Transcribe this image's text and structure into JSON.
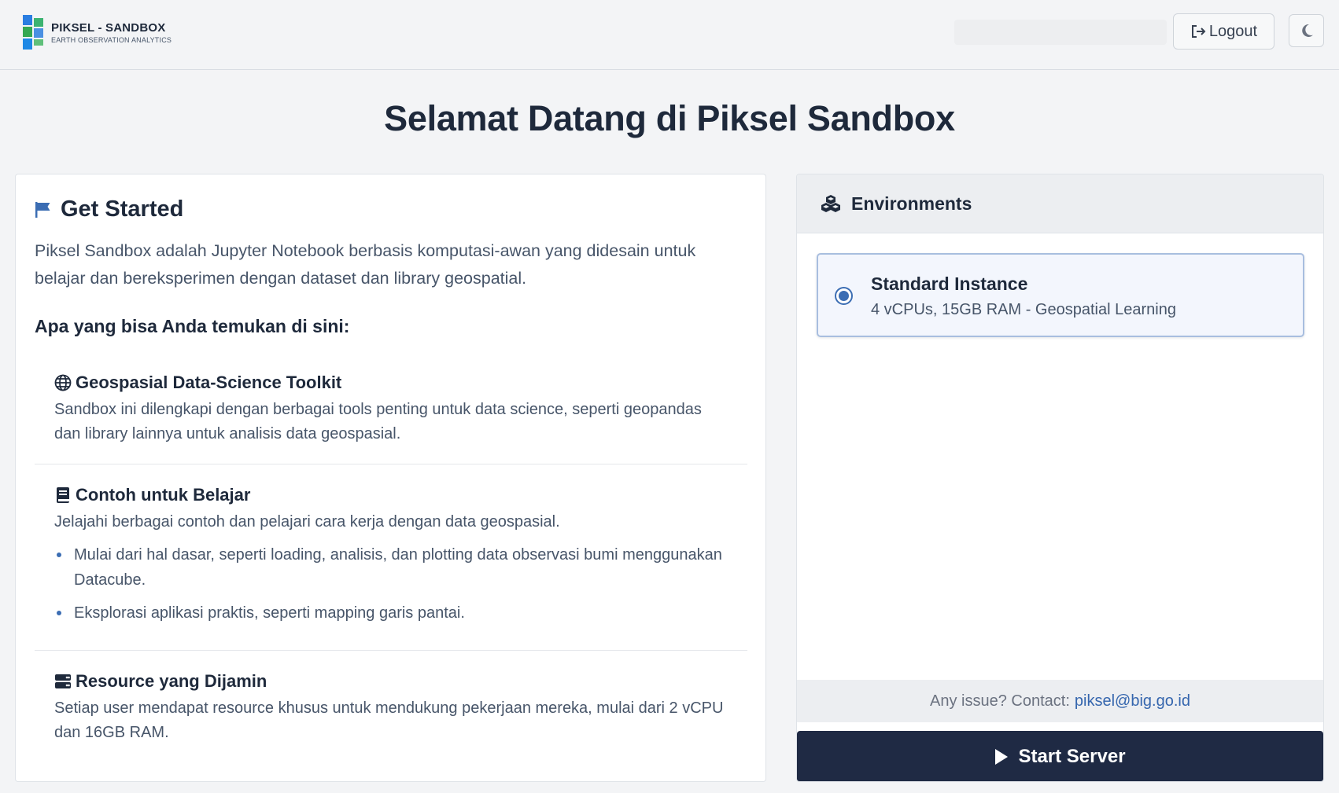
{
  "header": {
    "logo_title": "PIKSEL - SANDBOX",
    "logo_subtitle": "EARTH OBSERVATION ANALYTICS",
    "logout_label": "Logout",
    "logout_icon": "sign-out-icon",
    "theme_icon": "moon-icon"
  },
  "page_title": "Selamat Datang di Piksel Sandbox",
  "get_started": {
    "title": "Get Started",
    "icon": "flag-icon",
    "intro": "Piksel Sandbox adalah Jupyter Notebook berbasis komputasi-awan yang didesain untuk belajar dan bereksperimen dengan dataset dan library geospatial.",
    "find_heading": "Apa yang bisa Anda temukan di sini:",
    "features": [
      {
        "icon": "globe-icon",
        "title": "Geospasial Data-Science Toolkit",
        "desc": "Sandbox ini dilengkapi dengan berbagai tools penting untuk data science, seperti geopandas dan library lainnya untuk analisis data geospasial."
      },
      {
        "icon": "book-icon",
        "title": "Contoh untuk Belajar",
        "desc": "Jelajahi berbagai contoh dan pelajari cara kerja dengan data geospasial.",
        "bullets": [
          "Mulai dari hal dasar, seperti loading, analisis, dan plotting data observasi bumi menggunakan Datacube.",
          "Eksplorasi aplikasi praktis, seperti mapping garis pantai."
        ]
      },
      {
        "icon": "server-icon",
        "title": "Resource yang Dijamin",
        "desc": "Setiap user mendapat resource khusus untuk mendukung pekerjaan mereka, mulai dari 2 vCPU dan 16GB RAM."
      }
    ]
  },
  "environments": {
    "title": "Environments",
    "icon": "cubes-icon",
    "instance": {
      "name": "Standard Instance",
      "spec": "4 vCPUs, 15GB RAM - Geospatial Learning",
      "selected": true
    },
    "contact_prefix": "Any issue? Contact:",
    "contact_email": "piksel@big.go.id",
    "start_label": "Start Server",
    "start_icon": "play-icon"
  },
  "colors": {
    "accent": "#3b6db3",
    "dark_button": "#1f2a44",
    "background": "#f3f4f6",
    "link": "#3566ae"
  }
}
